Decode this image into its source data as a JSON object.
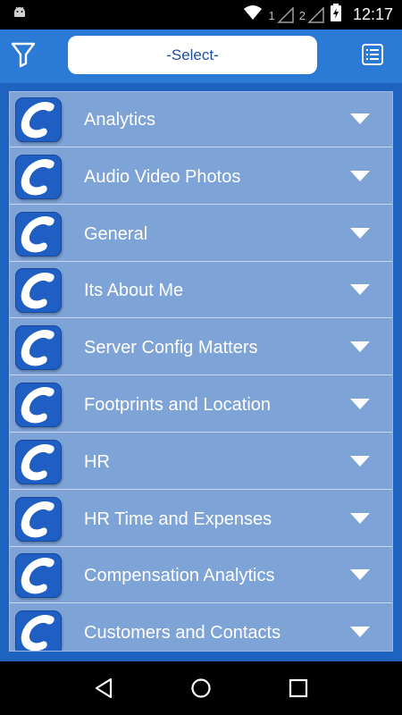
{
  "status_bar": {
    "time": "12:17",
    "sim1": "1",
    "sim2": "2",
    "icons": [
      "android-icon",
      "wifi-icon",
      "signal-icon",
      "battery-icon"
    ]
  },
  "toolbar": {
    "select_value": "-Select-",
    "filter_icon": "filter-icon",
    "list_icon": "list-icon"
  },
  "categories": [
    {
      "label": "Analytics"
    },
    {
      "label": "Audio Video Photos"
    },
    {
      "label": "General"
    },
    {
      "label": "Its About Me"
    },
    {
      "label": "Server Config Matters"
    },
    {
      "label": "Footprints and Location"
    },
    {
      "label": "HR"
    },
    {
      "label": "HR Time and Expenses"
    },
    {
      "label": "Compensation Analytics"
    },
    {
      "label": "Customers and Contacts"
    }
  ],
  "colors": {
    "app_bg": "#1f63c0",
    "toolbar_bg": "#2a7ad6",
    "row_bg": "#7ea3d6",
    "select_text": "#1b4fa6"
  },
  "nav": {
    "icons": [
      "back-icon",
      "home-icon",
      "recents-icon"
    ]
  }
}
